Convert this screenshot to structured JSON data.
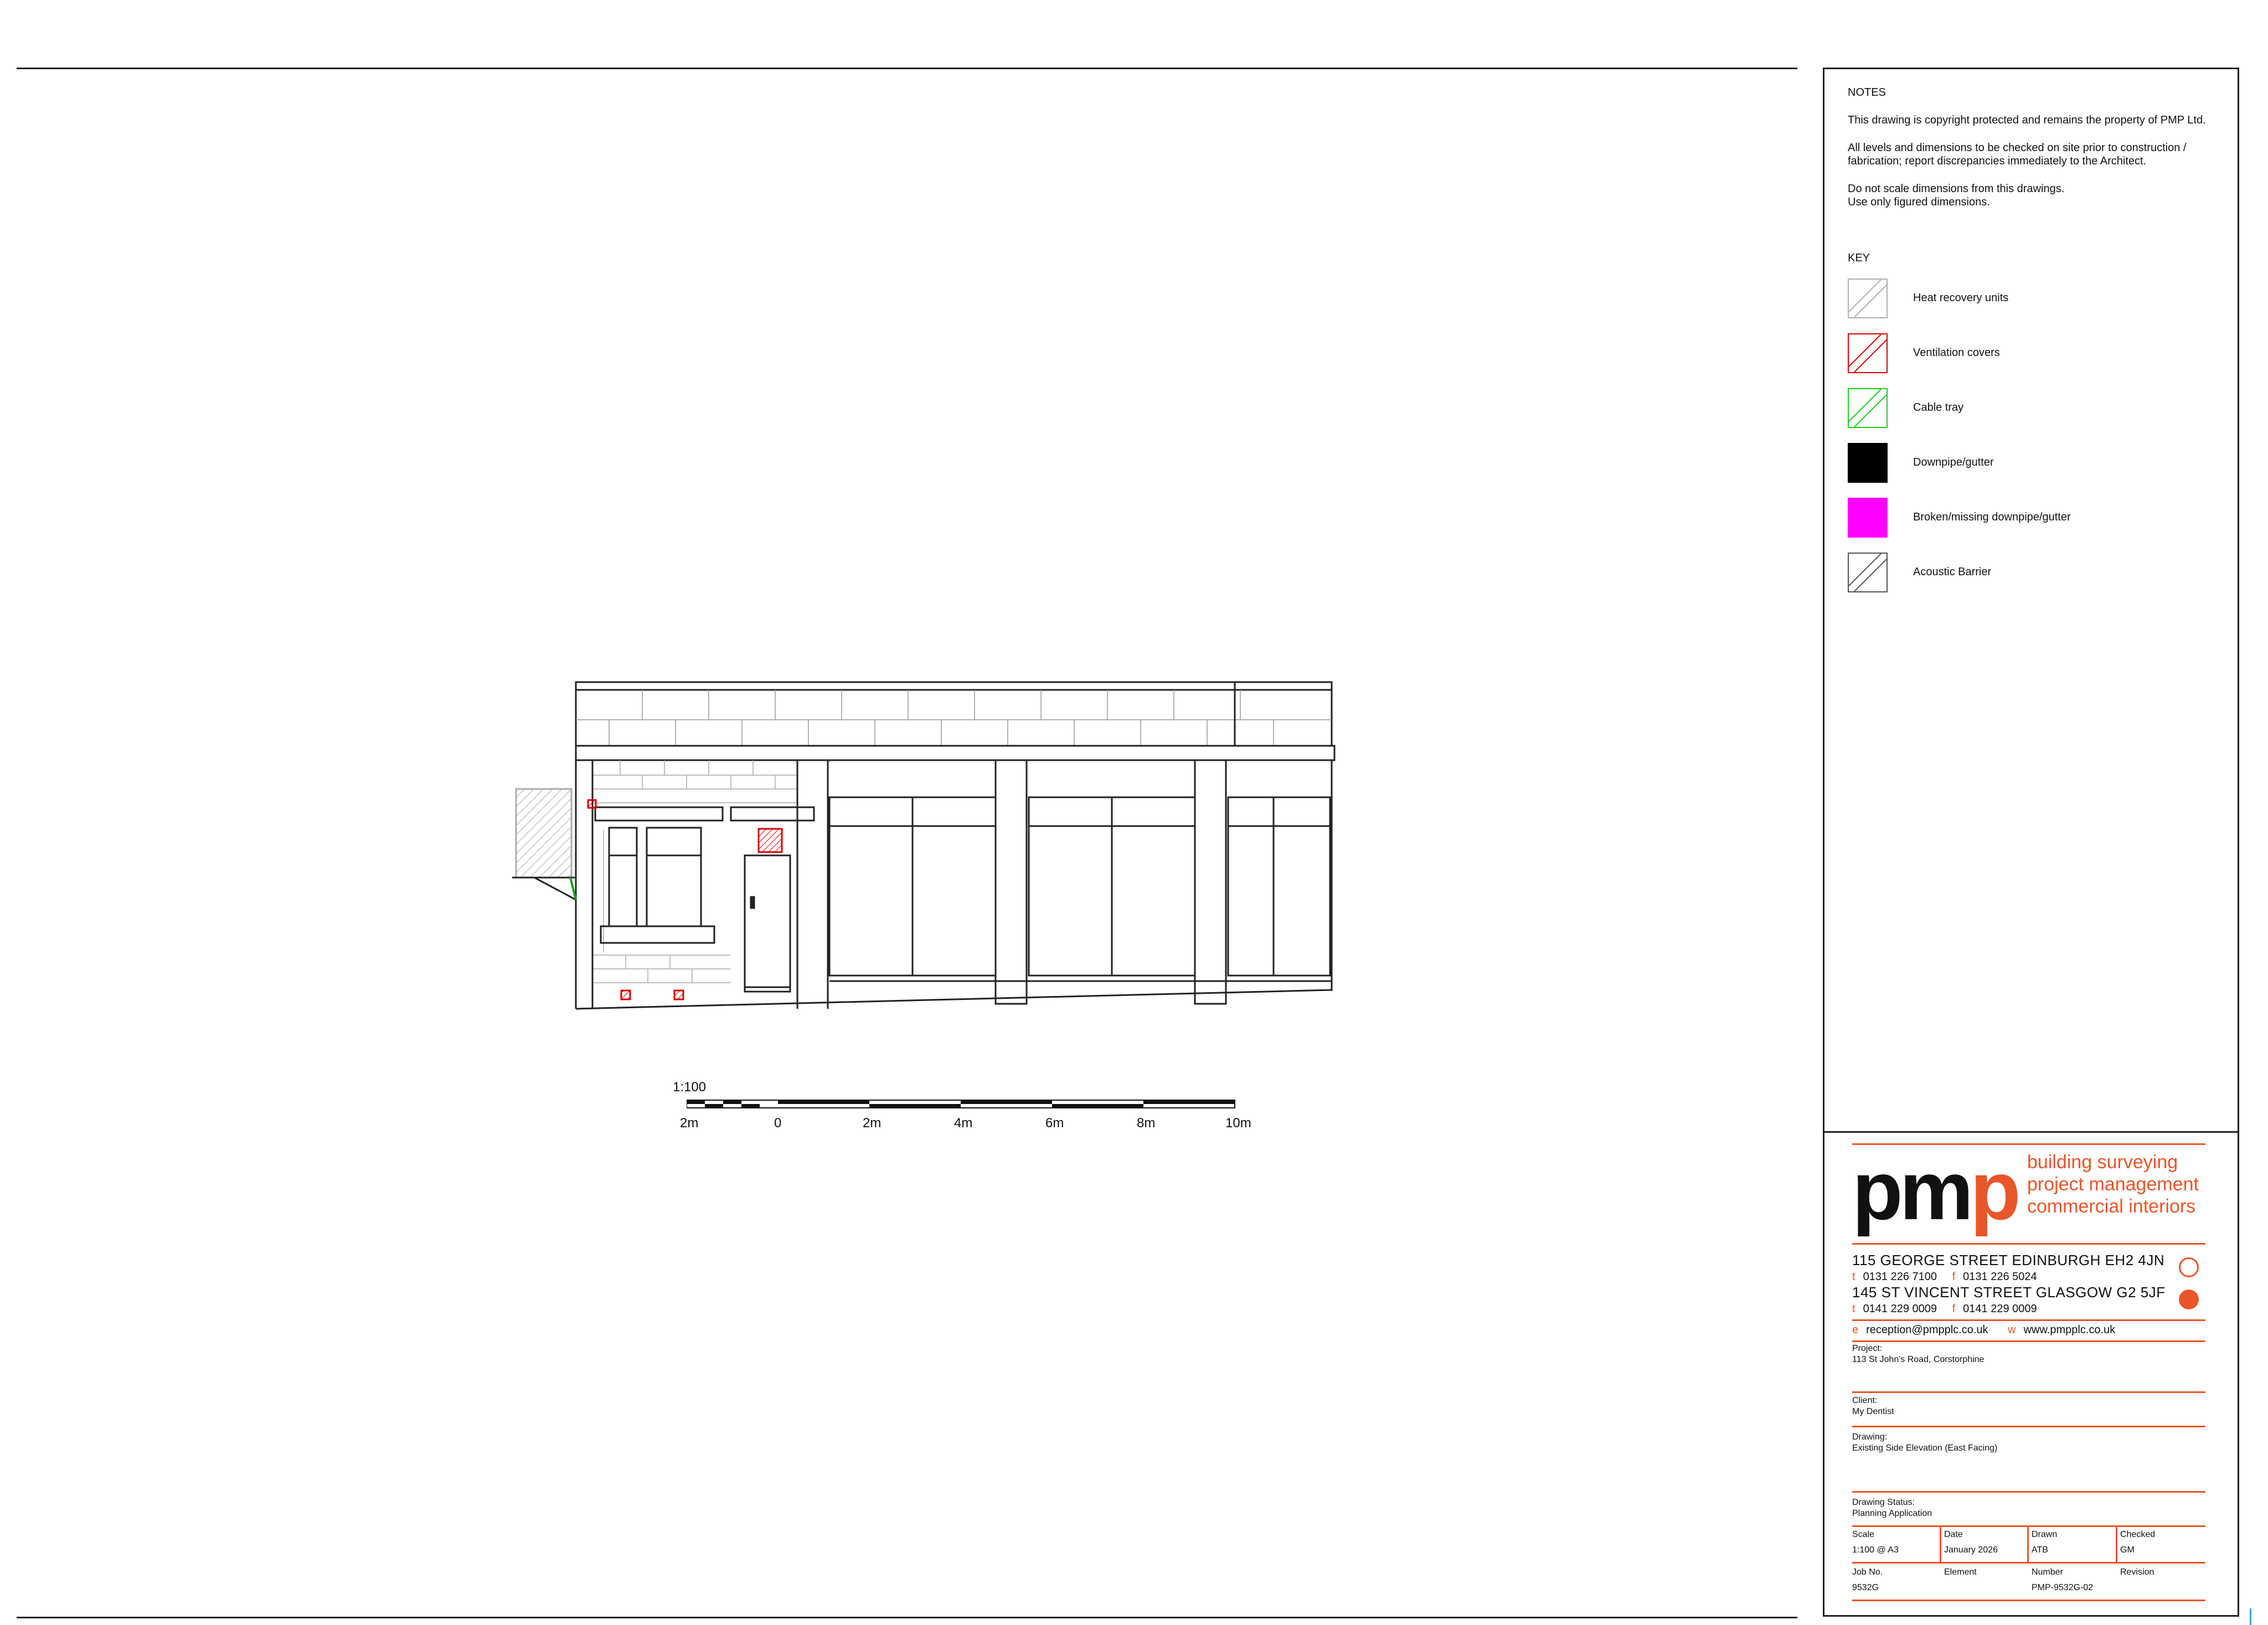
{
  "notes": {
    "heading": "NOTES",
    "paragraphs": [
      "This drawing is copyright protected and remains the property of PMP Ltd.",
      "All levels and dimensions to be checked on site prior to construction / fabrication; report discrepancies immediately to the Architect.",
      "Do not scale dimensions from this drawings.",
      "Use only figured dimensions."
    ]
  },
  "key": {
    "title": "KEY",
    "items": [
      {
        "label": "Heat recovery units",
        "color": "#b0b0b0",
        "style": "hatch"
      },
      {
        "label": "Ventilation covers",
        "color": "#dd0000",
        "style": "hatch"
      },
      {
        "label": "Cable tray",
        "color": "#22cc22",
        "style": "hatch"
      },
      {
        "label": "Downpipe/gutter",
        "color": "#000000",
        "style": "solid"
      },
      {
        "label": "Broken/missing downpipe/gutter",
        "color": "#ff00ff",
        "style": "solid"
      },
      {
        "label": "Acoustic Barrier",
        "color": "#555555",
        "style": "hatch"
      }
    ]
  },
  "scale_bar": {
    "ratio": "1:100",
    "ticks": [
      "2m",
      "0",
      "2m",
      "4m",
      "6m",
      "8m",
      "10m"
    ]
  },
  "title_block": {
    "logo_text_1": "pm",
    "logo_text_2": "p",
    "tagline": [
      "building surveying",
      "project management",
      "commercial interiors"
    ],
    "office_1": {
      "address": "115 GEORGE STREET  EDINBURGH  EH2 4JN",
      "t_key": "t",
      "tel": "0131 226 7100",
      "f_key": "f",
      "fax": "0131 226 5024"
    },
    "office_2": {
      "address": "145  ST VINCENT STREET  GLASGOW  G2 5JF",
      "t_key": "t",
      "tel": "0141 229 0009",
      "f_key": "f",
      "fax": "0141 229 0009"
    },
    "email_key": "e",
    "email": "reception@pmpplc.co.uk",
    "web_key": "w",
    "web": "www.pmpplc.co.uk",
    "project_label": "Project:",
    "project": "113 St John's Road, Corstorphine",
    "client_label": "Client:",
    "client": "My Dentist",
    "drawing_label": "Drawing:",
    "drawing": "Existing Side Elevation (East Facing)",
    "status_label": "Drawing Status:",
    "status": "Planning Application",
    "scale_label": "Scale",
    "scale": "1:100 @ A3",
    "date_label": "Date",
    "date": "January 2026",
    "drawn_label": "Drawn",
    "drawn": "ATB",
    "checked_label": "Checked",
    "checked": "GM",
    "job_label": "Job No.",
    "job": "9532G",
    "element_label": "Element",
    "element": "",
    "number_label": "Number",
    "number": "PMP-9532G-02",
    "revision_label": "Revision",
    "revision": "",
    "accent": "#e8562a"
  }
}
